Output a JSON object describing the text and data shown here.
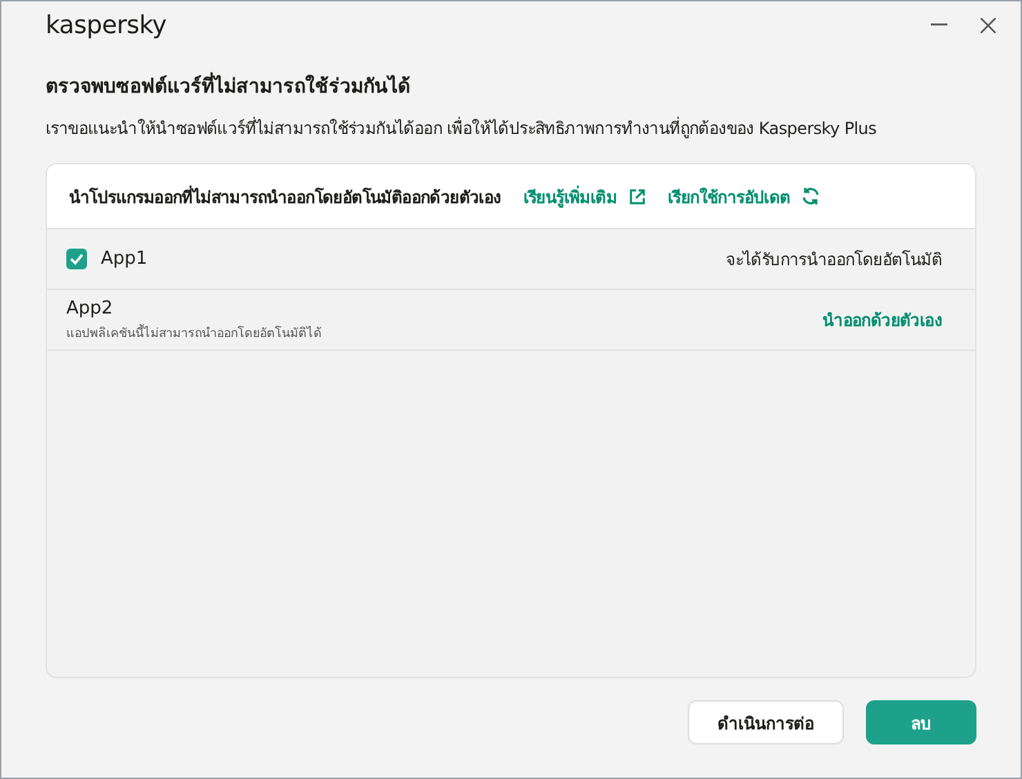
{
  "window": {
    "logo": "kaspersky"
  },
  "heading": "ตรวจพบซอฟต์แวร์ที่ไม่สามารถใช้ร่วมกันได้",
  "description": "เราขอแนะนำให้นำซอฟต์แวร์ที่ไม่สามารถใช้ร่วมกันได้ออก เพื่อให้ได้ประสิทธิภาพการทำงานที่ถูกต้องของ Kaspersky Plus",
  "panel": {
    "title": "นำโปรแกรมออกที่ไม่สามารถนำออกโดยอัตโนมัติออกด้วยตัวเอง",
    "links": [
      {
        "label": "เรียนรู้เพิ่มเติม",
        "kind": "external"
      },
      {
        "label": "เรียกใช้การอัปเดต",
        "kind": "refresh"
      }
    ]
  },
  "apps": [
    {
      "kind": "checkbox",
      "name": "App1",
      "checked": true,
      "status": "จะได้รับการนำออกโดยอัตโนมัติ"
    },
    {
      "kind": "manual",
      "name": "App2",
      "note": "แอปพลิเคชันนี้ไม่สามารถนำออกโดยอัตโนมัติได้",
      "action": "นำออกด้วยตัวเอง"
    }
  ],
  "buttons": [
    {
      "label": "ดำเนินการต่อ",
      "kind": "secondary"
    },
    {
      "label": "ลบ",
      "kind": "primary"
    }
  ]
}
